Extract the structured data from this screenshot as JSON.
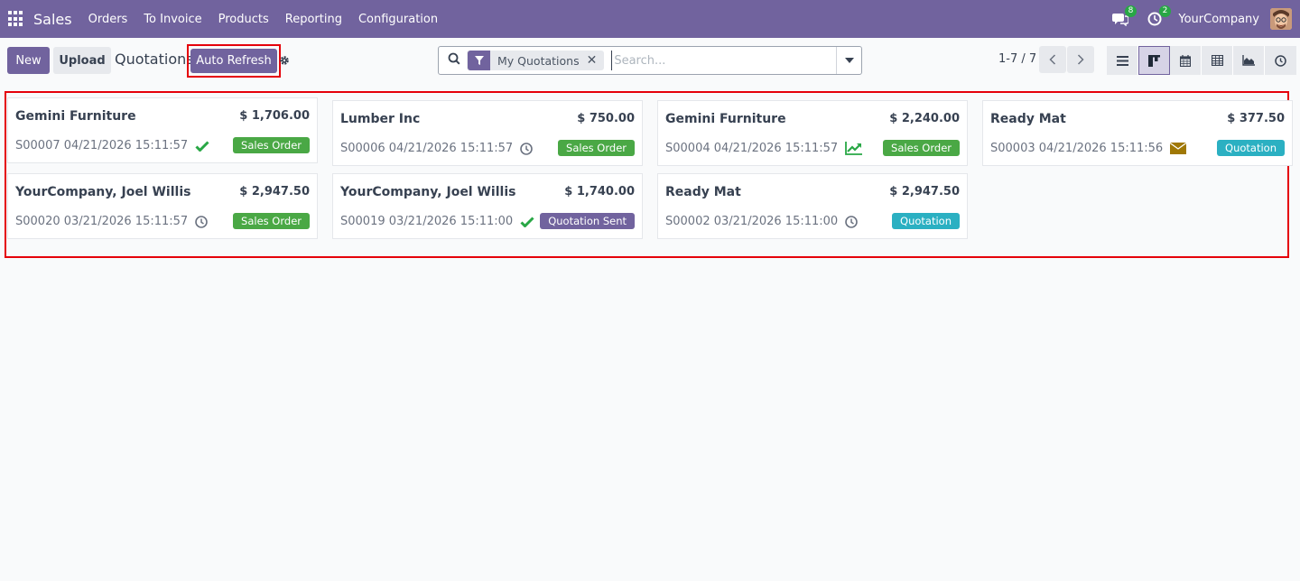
{
  "navbar": {
    "brand": "Sales",
    "menu": [
      "Orders",
      "To Invoice",
      "Products",
      "Reporting",
      "Configuration"
    ],
    "messages_count": "8",
    "activities_count": "2",
    "company": "YourCompany"
  },
  "control_panel": {
    "new_label": "New",
    "upload_label": "Upload",
    "title": "Quotations",
    "auto_refresh_label": "Auto Refresh",
    "search": {
      "facet": "My Quotations",
      "placeholder": "Search..."
    },
    "pager": "1-7 / 7"
  },
  "colors": {
    "brand": "#71639e",
    "badge_sales_order": "#4aa845",
    "badge_quotation_sent": "#71639e",
    "badge_quotation": "#2bb0c2",
    "highlight": "#e5000a"
  },
  "cards": [
    {
      "name": "Gemini Furniture",
      "amount": "$ 1,706.00",
      "ref": "S00007 04/21/2026 15:11:57",
      "status_icon": "check-icon",
      "badge": "Sales Order"
    },
    {
      "name": "Lumber Inc",
      "amount": "$ 750.00",
      "ref": "S00006 04/21/2026 15:11:57",
      "status_icon": "clock-icon",
      "badge": "Sales Order"
    },
    {
      "name": "Gemini Furniture",
      "amount": "$ 2,240.00",
      "ref": "S00004 04/21/2026 15:11:57",
      "status_icon": "chart-line-icon",
      "badge": "Sales Order"
    },
    {
      "name": "Ready Mat",
      "amount": "$ 377.50",
      "ref": "S00003 04/21/2026 15:11:56",
      "status_icon": "envelope-icon",
      "badge": "Quotation"
    },
    {
      "name": "YourCompany, Joel Willis",
      "amount": "$ 2,947.50",
      "ref": "S00020 03/21/2026 15:11:57",
      "status_icon": "clock-icon",
      "badge": "Sales Order"
    },
    {
      "name": "YourCompany, Joel Willis",
      "amount": "$ 1,740.00",
      "ref": "S00019 03/21/2026 15:11:00",
      "status_icon": "check-icon",
      "badge": "Quotation Sent"
    },
    {
      "name": "Ready Mat",
      "amount": "$ 2,947.50",
      "ref": "S00002 03/21/2026 15:11:00",
      "status_icon": "clock-icon",
      "badge": "Quotation"
    }
  ]
}
